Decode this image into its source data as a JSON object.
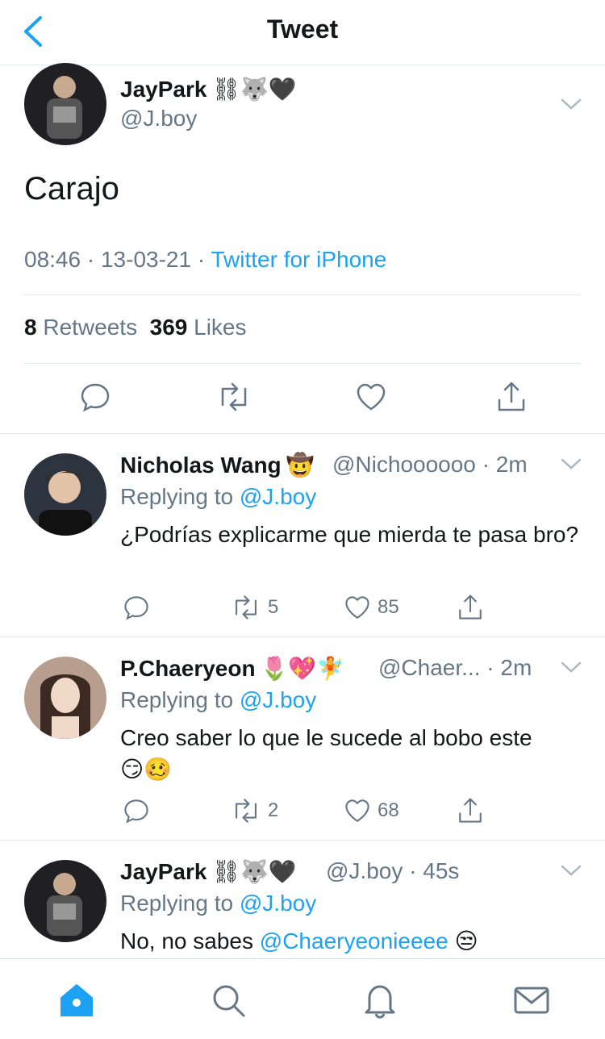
{
  "header": {
    "title": "Tweet"
  },
  "tweet": {
    "name": "JayPark",
    "name_emoji": "⛓🐺🖤",
    "handle": "@J.boy",
    "text": "Carajo",
    "time": "08:46",
    "date": "13-03-21",
    "source": "Twitter for iPhone",
    "retweets_count": "8",
    "retweets_label": "Retweets",
    "likes_count": "369",
    "likes_label": "Likes"
  },
  "replies": [
    {
      "name": "Nicholas Wang",
      "name_emoji": "🤠",
      "handle": "@Nichoooooo",
      "time": "2m",
      "replying_prefix": "Replying to",
      "replying_to": "@J.boy",
      "text": "¿Podrías explicarme que mierda te pasa bro?",
      "retweets": "5",
      "likes": "85"
    },
    {
      "name": "P.Chaeryeon",
      "name_emoji": "🌷💖🧚",
      "handle": "@Chaer...",
      "time": "2m",
      "replying_prefix": "Replying to",
      "replying_to": "@J.boy",
      "text": "Creo saber lo que le sucede al bobo este",
      "text_emoji": "😏🥴",
      "retweets": "2",
      "likes": "68"
    },
    {
      "name": "JayPark",
      "name_emoji": "⛓🐺🖤",
      "handle": "@J.boy",
      "time": "45s",
      "replying_prefix": "Replying to",
      "replying_to": "@J.boy",
      "text_prefix": "No, no sabes",
      "text_mention": "@Chaeryeonieeee",
      "text_emoji": "😒"
    }
  ],
  "tabs": [
    "home-icon",
    "search-icon",
    "notifications-icon",
    "messages-icon"
  ],
  "colors": {
    "accent": "#1da1f2",
    "secondary_text": "#657786",
    "divider": "#e1e8ed"
  }
}
